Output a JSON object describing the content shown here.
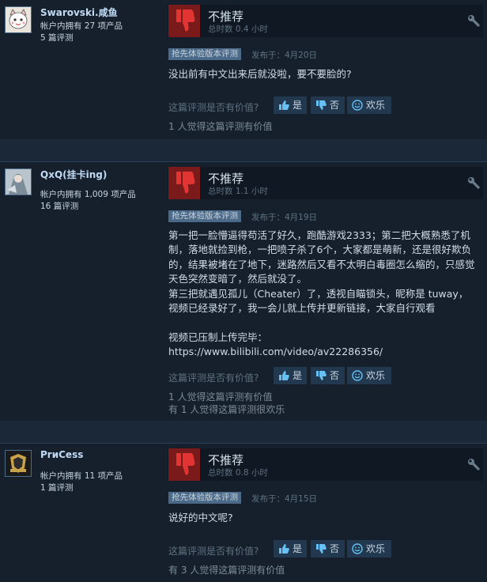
{
  "ui": {
    "helpful_q": "这篇评测是否有价值?",
    "yes": "是",
    "no": "否",
    "funny": "欢乐",
    "ea_badge": "抢先体验版本评测"
  },
  "colors": {
    "thumb_down_bg": "#7a1a1a",
    "thumb_down_fg": "#e33434",
    "badge_bg": "#4b6a8a"
  },
  "reviews": [
    {
      "name": "Swarovski.咸鱼",
      "products": "帐户内拥有 27 项产品",
      "review_count": "5 篇评测",
      "verdict": "不推荐",
      "hours": "总时数 0.4 小时",
      "date": "发布于：4月20日",
      "body": "没出前有中文出来后就没啦，要不要脸的?",
      "stats": "1 人觉得这篇评测有价值",
      "avatar_icon": "cartoon-cat-avatar-icon"
    },
    {
      "name": "QxQ(挂卡ing)",
      "products": "帐户内拥有 1,009 项产品",
      "review_count": "16 篇评测",
      "verdict": "不推荐",
      "hours": "总时数 1.1 小时",
      "date": "发布于：4月19日",
      "body": "第一把一脸懵逼得苟活了好久，跑酷游戏2333；第二把大概熟悉了机制，落地就捡到枪，一把喷子杀了6个，大家都是萌新，还是很好欺负的，结果被堵在了地下，迷路然后又看不太明白毒圈怎么缩的，只感觉天色突然变暗了，然后就没了。\n第三把就遇见孤儿（Cheater）了，透视自瞄锁头，昵称是 tuway，视频已经录好了，我一会儿就上传并更新链接，大家自行观看\n\n视频已压制上传完毕：\nhttps://www.bilibili.com/video/av22286356/",
      "stats": "1 人觉得这篇评测有价值\n有 1 人觉得这篇评测很欢乐",
      "avatar_icon": "anime-character-avatar-icon"
    },
    {
      "name": "PrиCess",
      "products": "帐户内拥有 11 项产品",
      "review_count": "1 篇评测",
      "verdict": "不推荐",
      "hours": "总时数 0.8 小时",
      "date": "发布于：4月15日",
      "body": "说好的中文呢?",
      "stats": "有 3 人觉得这篇评测有价值",
      "avatar_icon": "team-logo-avatar-icon"
    }
  ]
}
